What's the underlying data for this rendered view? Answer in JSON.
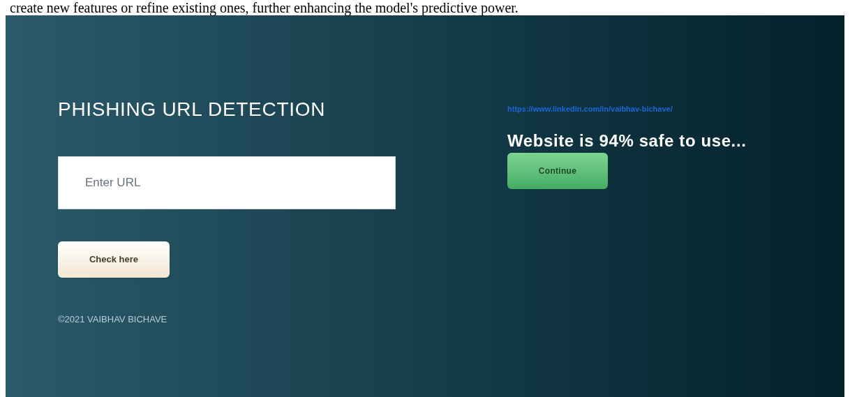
{
  "document_text": "create new features or refine existing ones, further enhancing the model's predictive power.",
  "app": {
    "title": "PHISHING URL DETECTION",
    "url_field": {
      "placeholder": "Enter URL"
    },
    "check_button": "Check here",
    "copyright": "©2021 VAIBHAV BICHAVE",
    "profile_link": "https://www.linkedin.com/in/vaibhav-bichave/",
    "result": "Website is 94% safe to use...",
    "continue_button": "Continue"
  }
}
